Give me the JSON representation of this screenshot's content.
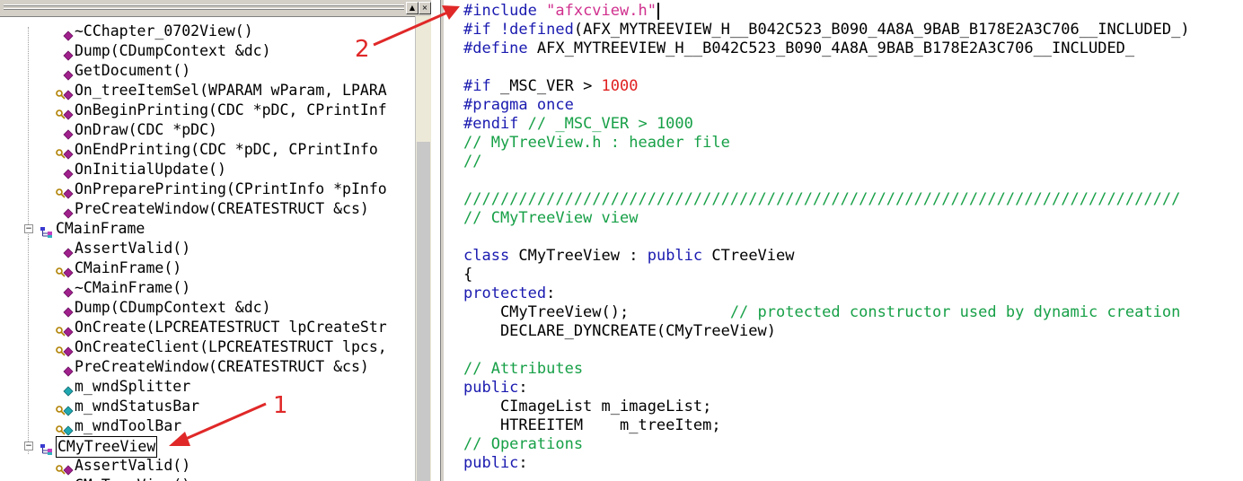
{
  "tree": {
    "rows": [
      {
        "text": "~CChapter_0702View()",
        "icon": "method-icon",
        "indent": 70,
        "kind": "method"
      },
      {
        "text": "Dump(CDumpContext &dc)",
        "icon": "method-icon",
        "indent": 70,
        "kind": "method"
      },
      {
        "text": "GetDocument()",
        "icon": "method-icon",
        "indent": 70,
        "kind": "method"
      },
      {
        "text": "On_treeItemSel(WPARAM wParam, LPARA",
        "icon": "key-method-icon",
        "indent": 62,
        "kind": "protected"
      },
      {
        "text": "OnBeginPrinting(CDC *pDC, CPrintInf",
        "icon": "key-method-icon",
        "indent": 62,
        "kind": "protected"
      },
      {
        "text": "OnDraw(CDC *pDC)",
        "icon": "method-icon",
        "indent": 70,
        "kind": "method"
      },
      {
        "text": "OnEndPrinting(CDC *pDC, CPrintInfo ",
        "icon": "key-method-icon",
        "indent": 62,
        "kind": "protected"
      },
      {
        "text": "OnInitialUpdate()",
        "icon": "method-icon",
        "indent": 70,
        "kind": "method"
      },
      {
        "text": "OnPreparePrinting(CPrintInfo *pInfo",
        "icon": "key-method-icon",
        "indent": 62,
        "kind": "protected"
      },
      {
        "text": "PreCreateWindow(CREATESTRUCT &cs)",
        "icon": "method-icon",
        "indent": 70,
        "kind": "method"
      },
      {
        "text": "CMainFrame",
        "icon": "class-icon",
        "indent": 44,
        "kind": "class",
        "toggle": "−"
      },
      {
        "text": "AssertValid()",
        "icon": "method-icon",
        "indent": 70,
        "kind": "method"
      },
      {
        "text": "CMainFrame()",
        "icon": "key-method-icon",
        "indent": 62,
        "kind": "protected"
      },
      {
        "text": "~CMainFrame()",
        "icon": "method-icon",
        "indent": 70,
        "kind": "method"
      },
      {
        "text": "Dump(CDumpContext &dc)",
        "icon": "method-icon",
        "indent": 70,
        "kind": "method"
      },
      {
        "text": "OnCreate(LPCREATESTRUCT lpCreateStr",
        "icon": "key-method-icon",
        "indent": 62,
        "kind": "protected"
      },
      {
        "text": "OnCreateClient(LPCREATESTRUCT lpcs,",
        "icon": "key-method-icon",
        "indent": 62,
        "kind": "protected"
      },
      {
        "text": "PreCreateWindow(CREATESTRUCT &cs)",
        "icon": "method-icon",
        "indent": 70,
        "kind": "method"
      },
      {
        "text": "m_wndSplitter",
        "icon": "member-icon",
        "indent": 70,
        "kind": "member"
      },
      {
        "text": "m_wndStatusBar",
        "icon": "key-member-icon",
        "indent": 62,
        "kind": "protected-member"
      },
      {
        "text": "m_wndToolBar",
        "icon": "key-member-icon",
        "indent": 62,
        "kind": "protected-member"
      },
      {
        "text": "CMyTreeView",
        "icon": "class-icon",
        "indent": 44,
        "kind": "class",
        "toggle": "−",
        "selected": true
      },
      {
        "text": "AssertValid()",
        "icon": "key-method-icon",
        "indent": 62,
        "kind": "protected"
      },
      {
        "text": "CMyTreeView()",
        "icon": "key-method-icon",
        "indent": 62,
        "kind": "protected"
      }
    ]
  },
  "code": {
    "lines": [
      [
        {
          "t": "#include ",
          "c": "kw"
        },
        {
          "t": "\"afxcview.h\"",
          "c": "st"
        }
      ],
      [
        {
          "t": "#if !defined",
          "c": "kw"
        },
        {
          "t": "(AFX_MYTREEVIEW_H__B042C523_B090_4A8A_9BAB_B178E2A3C706__INCLUDED_)",
          "c": ""
        }
      ],
      [
        {
          "t": "#define ",
          "c": "kw"
        },
        {
          "t": "AFX_MYTREEVIEW_H__B042C523_B090_4A8A_9BAB_B178E2A3C706__INCLUDED_",
          "c": ""
        }
      ],
      [],
      [
        {
          "t": "#if ",
          "c": "kw"
        },
        {
          "t": "_MSC_VER > ",
          "c": ""
        },
        {
          "t": "1000",
          "c": "nm"
        }
      ],
      [
        {
          "t": "#pragma once",
          "c": "kw"
        }
      ],
      [
        {
          "t": "#endif ",
          "c": "kw"
        },
        {
          "t": "// _MSC_VER > 1000",
          "c": "cm"
        }
      ],
      [
        {
          "t": "// MyTreeView.h : header file",
          "c": "cm"
        }
      ],
      [
        {
          "t": "//",
          "c": "cm"
        }
      ],
      [],
      [
        {
          "t": "//////////////////////////////////////////////////////////////////////////////",
          "c": "cm"
        }
      ],
      [
        {
          "t": "// CMyTreeView view",
          "c": "cm"
        }
      ],
      [],
      [
        {
          "t": "class ",
          "c": "kw"
        },
        {
          "t": "CMyTreeView : ",
          "c": ""
        },
        {
          "t": "public ",
          "c": "kw"
        },
        {
          "t": "CTreeView",
          "c": ""
        }
      ],
      [
        {
          "t": "{",
          "c": ""
        }
      ],
      [
        {
          "t": "protected",
          "c": "kw"
        },
        {
          "t": ":",
          "c": ""
        }
      ],
      [
        {
          "t": "    CMyTreeView();           ",
          "c": ""
        },
        {
          "t": "// protected constructor used by dynamic creation",
          "c": "cm"
        }
      ],
      [
        {
          "t": "    DECLARE_DYNCREATE(CMyTreeView)",
          "c": ""
        }
      ],
      [],
      [
        {
          "t": "// Attributes",
          "c": "cm"
        }
      ],
      [
        {
          "t": "public",
          "c": "kw"
        },
        {
          "t": ":",
          "c": ""
        }
      ],
      [
        {
          "t": "    CImageList m_imageList;",
          "c": ""
        }
      ],
      [
        {
          "t": "    HTREEITEM    m_treeItem;",
          "c": ""
        }
      ],
      [
        {
          "t": "// Operations",
          "c": "cm"
        }
      ],
      [
        {
          "t": "public",
          "c": "kw"
        },
        {
          "t": ":",
          "c": ""
        }
      ]
    ]
  },
  "annotations": {
    "label_1": "1",
    "label_2": "2",
    "color": "#e02828"
  }
}
